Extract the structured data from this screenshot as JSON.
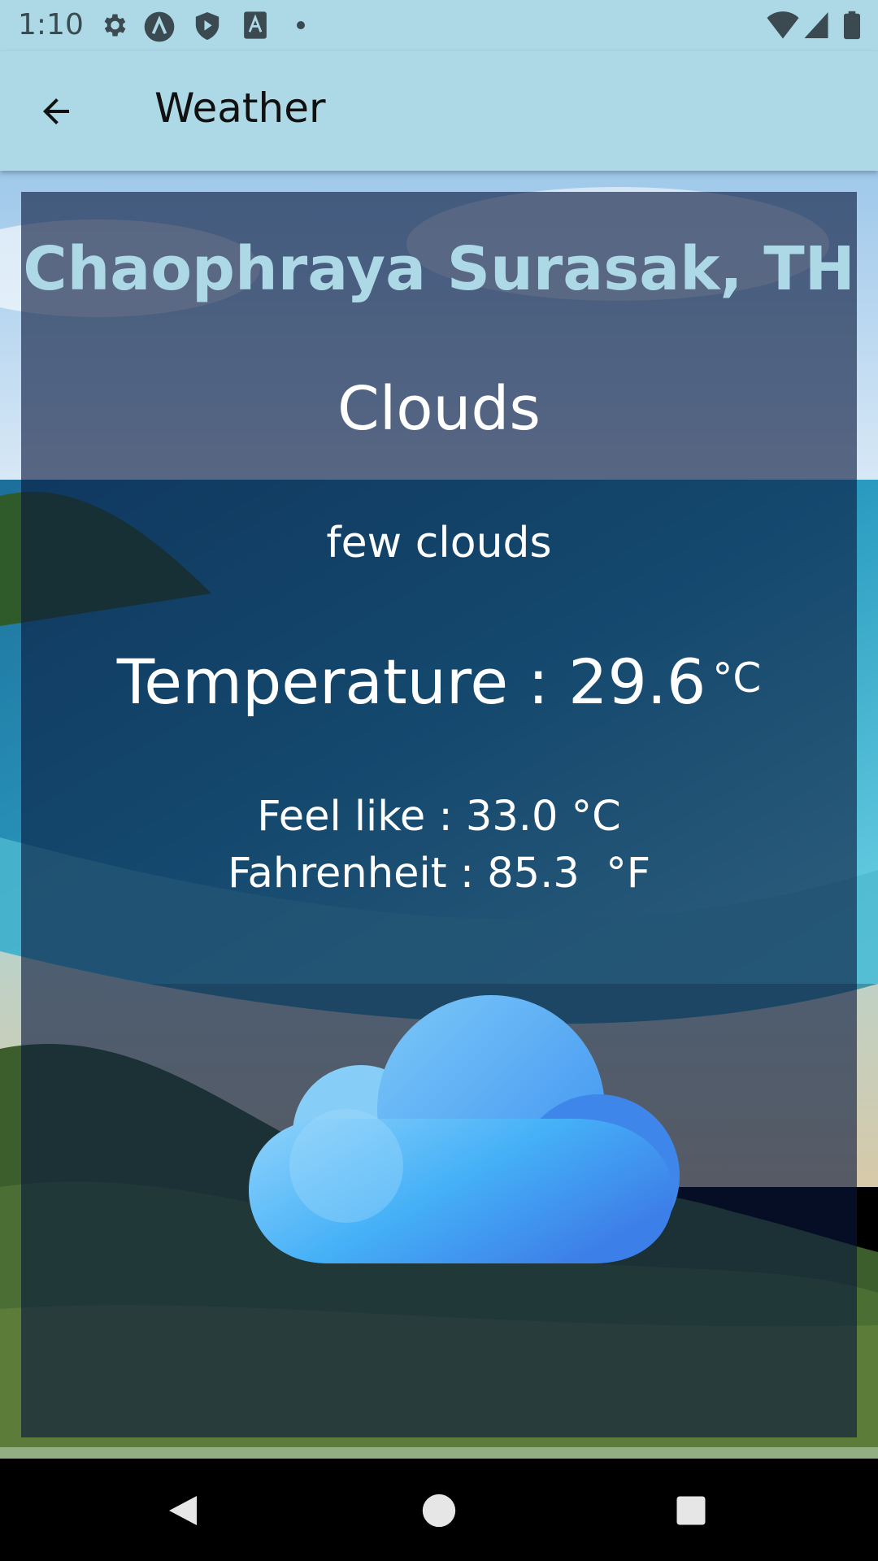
{
  "status_bar": {
    "time": "1:10",
    "icons": [
      "settings-icon",
      "app-a-icon",
      "shield-play-icon",
      "font-a-icon",
      "dot-icon"
    ],
    "right_icons": [
      "wifi-icon",
      "signal-icon",
      "battery-icon"
    ]
  },
  "app_bar": {
    "title": "Weather",
    "back_icon": "arrow-back-icon",
    "color": "#add8e6"
  },
  "weather": {
    "city": "Chaophraya Surasak, TH",
    "condition": "Clouds",
    "description": "few clouds",
    "temperature_text": "Temperature : 29.6",
    "temperature_unit": "°C",
    "feels_like": "Feel like : 33.0 °C",
    "fahrenheit": "Fahrenheit : 85.3  °F",
    "icon": "cloud-icon",
    "city_color": "#add8e6"
  },
  "nav_bar": {
    "buttons": [
      "back-triangle-icon",
      "home-circle-icon",
      "recents-square-icon"
    ]
  }
}
